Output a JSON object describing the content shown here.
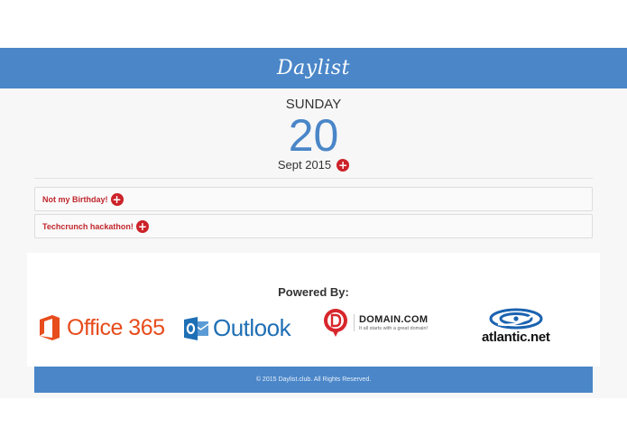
{
  "header": {
    "brand": "Daylist"
  },
  "date": {
    "weekday": "SUNDAY",
    "day": "20",
    "month_year": "Sept 2015",
    "add_symbol": "+"
  },
  "events": [
    {
      "label": "Not my Birthday!",
      "add_symbol": "+"
    },
    {
      "label": "Techcrunch hackathon!",
      "add_symbol": "+"
    }
  ],
  "powered_by": {
    "title": "Powered By:",
    "logos": {
      "office": {
        "text": "Office 365"
      },
      "outlook": {
        "text": "Outlook"
      },
      "domain": {
        "name": "DOMAIN.COM",
        "tagline": "It all starts with a great domain!"
      },
      "atlantic": {
        "text": "atlantic.net"
      }
    }
  },
  "footer": {
    "text": "© 2015 Daylist.club. All Rights Reserved."
  },
  "colors": {
    "brand_blue": "#4a86c8",
    "accent_red": "#cc2229",
    "office_orange": "#e74c1c",
    "outlook_blue": "#1f6fb5"
  }
}
